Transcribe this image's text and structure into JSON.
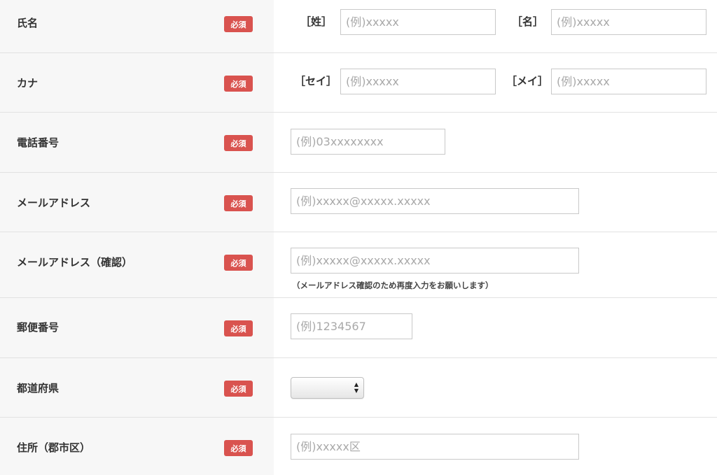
{
  "required_badge": "必須",
  "colors": {
    "badge": "#d9534f",
    "label_bg": "#f7f7f7",
    "border": "#e2e2e2"
  },
  "rows": {
    "name": {
      "label": "氏名",
      "sub1": "［姓］",
      "placeholder1": "(例)xxxxx",
      "sub2": "［名］",
      "placeholder2": "(例)xxxxx"
    },
    "kana": {
      "label": "カナ",
      "sub1": "［セイ］",
      "placeholder1": "(例)xxxxx",
      "sub2": "［メイ］",
      "placeholder2": "(例)xxxxx"
    },
    "phone": {
      "label": "電話番号",
      "placeholder": "(例)03xxxxxxxx"
    },
    "email": {
      "label": "メールアドレス",
      "placeholder": "(例)xxxxx@xxxxx.xxxxx"
    },
    "email_confirm": {
      "label": "メールアドレス（確認）",
      "placeholder": "(例)xxxxx@xxxxx.xxxxx",
      "note": "（メールアドレス確認のため再度入力をお願いします）"
    },
    "postal": {
      "label": "郵便番号",
      "placeholder": "(例)1234567"
    },
    "prefecture": {
      "label": "都道府県",
      "selected": "",
      "arrow_icon": "updown-arrows-icon"
    },
    "address": {
      "label": "住所（郡市区）",
      "placeholder": "(例)xxxxx区"
    }
  }
}
